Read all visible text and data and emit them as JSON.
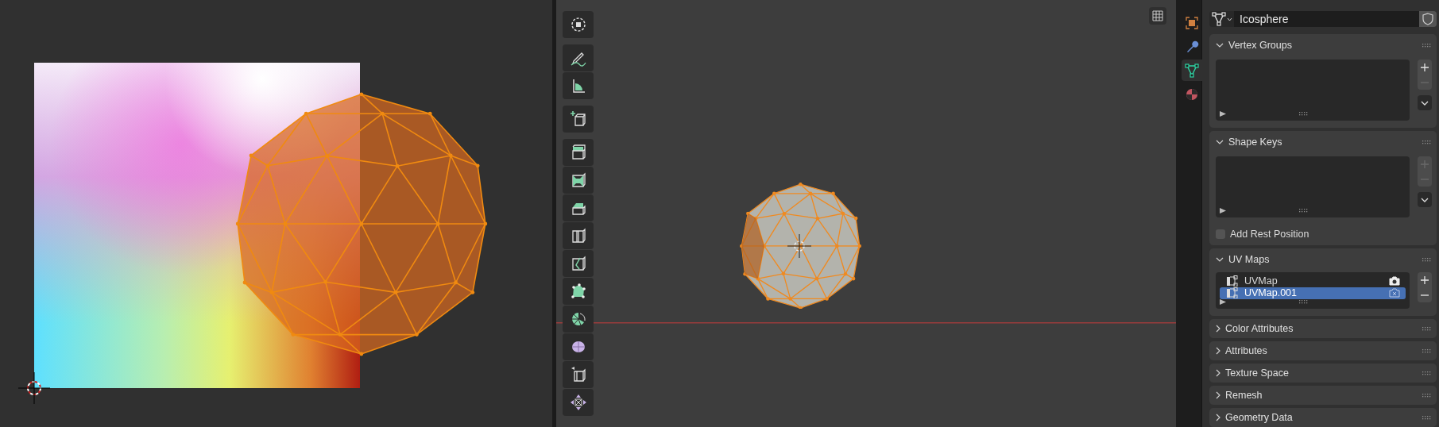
{
  "properties": {
    "tabs": [
      {
        "kind": "object",
        "selected": false
      },
      {
        "kind": "modifier",
        "selected": false
      },
      {
        "kind": "data",
        "selected": true
      },
      {
        "kind": "material",
        "selected": false
      }
    ],
    "datablock": {
      "name": "Icosphere"
    },
    "panels": [
      {
        "title": "Vertex Groups",
        "expanded": true,
        "kind": "list",
        "add_disabled": false,
        "remove_disabled": true,
        "specials_menu": true
      },
      {
        "title": "Shape Keys",
        "expanded": true,
        "kind": "list",
        "add_disabled": true,
        "remove_disabled": true,
        "specials_menu": true,
        "checkbox": {
          "label": "Add Rest Position",
          "checked": false
        }
      },
      {
        "title": "UV Maps",
        "expanded": true,
        "kind": "list",
        "add_disabled": false,
        "remove_disabled": false,
        "specials_menu": false,
        "items": [
          {
            "name": "UVMap",
            "selected": false,
            "active_render": true
          },
          {
            "name": "UVMap.001",
            "selected": true,
            "active_render": false
          }
        ]
      },
      {
        "title": "Color Attributes",
        "expanded": false,
        "kind": "section"
      },
      {
        "title": "Attributes",
        "expanded": false,
        "kind": "section"
      },
      {
        "title": "Texture Space",
        "expanded": false,
        "kind": "section"
      },
      {
        "title": "Remesh",
        "expanded": false,
        "kind": "section"
      },
      {
        "title": "Geometry Data",
        "expanded": false,
        "kind": "section"
      }
    ]
  }
}
